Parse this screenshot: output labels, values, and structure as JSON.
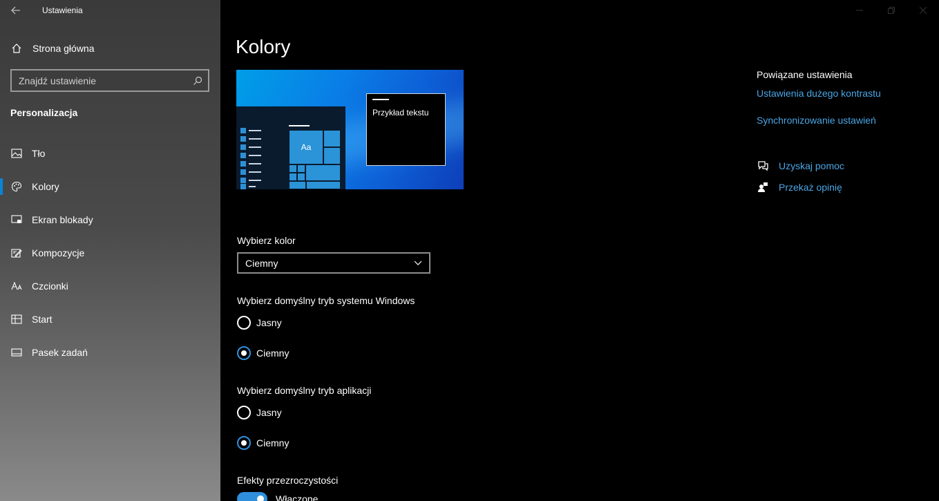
{
  "window": {
    "title": "Ustawienia",
    "back_icon": "arrow-left-icon",
    "controls": [
      "minimize-icon",
      "maximize-icon",
      "close-icon"
    ]
  },
  "sidebar": {
    "home_label": "Strona główna",
    "search_placeholder": "Znajdź ustawienie",
    "section_heading": "Personalizacja",
    "items": [
      {
        "label": "Tło",
        "icon": "image-icon"
      },
      {
        "label": "Kolory",
        "icon": "palette-icon",
        "active": true
      },
      {
        "label": "Ekran blokady",
        "icon": "lock-screen-icon"
      },
      {
        "label": "Kompozycje",
        "icon": "themes-icon"
      },
      {
        "label": "Czcionki",
        "icon": "fonts-icon"
      },
      {
        "label": "Start",
        "icon": "start-icon"
      },
      {
        "label": "Pasek zadań",
        "icon": "taskbar-icon"
      }
    ],
    "accent_color": "#0a84d6"
  },
  "main": {
    "title": "Kolory",
    "preview": {
      "sample_text": "Przykład tekstu",
      "tile_label": "Aa"
    },
    "choose_color": {
      "label": "Wybierz kolor",
      "value": "Ciemny"
    },
    "windows_mode": {
      "label": "Wybierz domyślny tryb systemu Windows",
      "options": [
        "Jasny",
        "Ciemny"
      ],
      "selected": "Ciemny"
    },
    "app_mode": {
      "label": "Wybierz domyślny tryb aplikacji",
      "options": [
        "Jasny",
        "Ciemny"
      ],
      "selected": "Ciemny"
    },
    "transparency": {
      "label": "Efekty przezroczystości",
      "state": "Włączone",
      "on": true
    }
  },
  "related": {
    "title": "Powiązane ustawienia",
    "links": [
      "Ustawienia dużego kontrastu",
      "Synchronizowanie ustawień"
    ],
    "help": "Uzyskaj pomoc",
    "feedback": "Przekaż opinię",
    "link_color": "#4aa6e6"
  }
}
